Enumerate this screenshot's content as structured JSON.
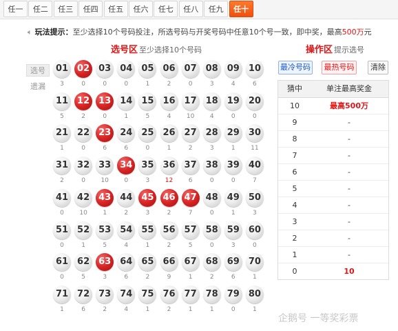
{
  "tabs": [
    "任一",
    "任二",
    "任三",
    "任四",
    "任五",
    "任六",
    "任七",
    "任八",
    "任九",
    "任十"
  ],
  "active_tab_index": 9,
  "tip": {
    "label": "玩法提示：",
    "text_before": "至少选择10个号码投注，所选号码与开奖号码中任意10个号一致，即中奖，最高",
    "amount": "500万",
    "text_after": "元"
  },
  "pick_area": {
    "title": "选号区",
    "subtitle": "至少选择10个号码"
  },
  "row_labels": {
    "pick": "选号",
    "miss": "遗漏"
  },
  "balls": [
    {
      "n": "01",
      "miss": "3",
      "sel": false
    },
    {
      "n": "02",
      "miss": "0",
      "sel": true
    },
    {
      "n": "03",
      "miss": "0",
      "sel": false
    },
    {
      "n": "04",
      "miss": "0",
      "sel": false
    },
    {
      "n": "05",
      "miss": "1",
      "sel": false
    },
    {
      "n": "06",
      "miss": "2",
      "sel": false
    },
    {
      "n": "07",
      "miss": "0",
      "sel": false
    },
    {
      "n": "08",
      "miss": "3",
      "sel": false
    },
    {
      "n": "09",
      "miss": "4",
      "sel": false
    },
    {
      "n": "10",
      "miss": "6",
      "sel": false
    },
    {
      "n": "11",
      "miss": "5",
      "sel": false
    },
    {
      "n": "12",
      "miss": "2",
      "sel": true
    },
    {
      "n": "13",
      "miss": "0",
      "sel": true
    },
    {
      "n": "14",
      "miss": "1",
      "sel": false
    },
    {
      "n": "15",
      "miss": "5",
      "sel": false
    },
    {
      "n": "16",
      "miss": "4",
      "sel": false
    },
    {
      "n": "17",
      "miss": "10",
      "sel": false
    },
    {
      "n": "18",
      "miss": "4",
      "sel": false
    },
    {
      "n": "19",
      "miss": "0",
      "sel": false
    },
    {
      "n": "20",
      "miss": "0",
      "sel": false
    },
    {
      "n": "21",
      "miss": "1",
      "sel": false
    },
    {
      "n": "22",
      "miss": "0",
      "sel": false
    },
    {
      "n": "23",
      "miss": "6",
      "sel": true
    },
    {
      "n": "24",
      "miss": "6",
      "sel": false
    },
    {
      "n": "25",
      "miss": "0",
      "sel": false
    },
    {
      "n": "26",
      "miss": "1",
      "sel": false
    },
    {
      "n": "27",
      "miss": "2",
      "sel": false
    },
    {
      "n": "28",
      "miss": "3",
      "sel": false
    },
    {
      "n": "29",
      "miss": "1",
      "sel": false
    },
    {
      "n": "30",
      "miss": "11",
      "sel": false
    },
    {
      "n": "31",
      "miss": "2",
      "sel": false
    },
    {
      "n": "32",
      "miss": "0",
      "sel": false
    },
    {
      "n": "33",
      "miss": "10",
      "sel": false
    },
    {
      "n": "34",
      "miss": "0",
      "sel": true
    },
    {
      "n": "35",
      "miss": "3",
      "sel": false
    },
    {
      "n": "36",
      "miss": "12",
      "sel": false,
      "red": true
    },
    {
      "n": "37",
      "miss": "6",
      "sel": false
    },
    {
      "n": "38",
      "miss": "0",
      "sel": false
    },
    {
      "n": "39",
      "miss": "0",
      "sel": false
    },
    {
      "n": "40",
      "miss": "7",
      "sel": false
    },
    {
      "n": "41",
      "miss": "0",
      "sel": false
    },
    {
      "n": "42",
      "miss": "10",
      "sel": false
    },
    {
      "n": "43",
      "miss": "1",
      "sel": true
    },
    {
      "n": "44",
      "miss": "2",
      "sel": false
    },
    {
      "n": "45",
      "miss": "3",
      "sel": true
    },
    {
      "n": "46",
      "miss": "2",
      "sel": true
    },
    {
      "n": "47",
      "miss": "7",
      "sel": true
    },
    {
      "n": "48",
      "miss": "0",
      "sel": false
    },
    {
      "n": "49",
      "miss": "1",
      "sel": false
    },
    {
      "n": "50",
      "miss": "3",
      "sel": false
    },
    {
      "n": "51",
      "miss": "0",
      "sel": false
    },
    {
      "n": "52",
      "miss": "1",
      "sel": false
    },
    {
      "n": "53",
      "miss": "5",
      "sel": false
    },
    {
      "n": "54",
      "miss": "4",
      "sel": false
    },
    {
      "n": "55",
      "miss": "1",
      "sel": false
    },
    {
      "n": "56",
      "miss": "2",
      "sel": false
    },
    {
      "n": "57",
      "miss": "5",
      "sel": false
    },
    {
      "n": "58",
      "miss": "0",
      "sel": false
    },
    {
      "n": "59",
      "miss": "3",
      "sel": false
    },
    {
      "n": "60",
      "miss": "0",
      "sel": false
    },
    {
      "n": "61",
      "miss": "0",
      "sel": false
    },
    {
      "n": "62",
      "miss": "5",
      "sel": false
    },
    {
      "n": "63",
      "miss": "3",
      "sel": true
    },
    {
      "n": "64",
      "miss": "6",
      "sel": false
    },
    {
      "n": "65",
      "miss": "2",
      "sel": false
    },
    {
      "n": "66",
      "miss": "9",
      "sel": false
    },
    {
      "n": "67",
      "miss": "1",
      "sel": false
    },
    {
      "n": "68",
      "miss": "2",
      "sel": false
    },
    {
      "n": "69",
      "miss": "6",
      "sel": false
    },
    {
      "n": "70",
      "miss": "1",
      "sel": false
    },
    {
      "n": "71",
      "miss": "1",
      "sel": false
    },
    {
      "n": "72",
      "miss": "6",
      "sel": false
    },
    {
      "n": "73",
      "miss": "2",
      "sel": false
    },
    {
      "n": "74",
      "miss": "4",
      "sel": false
    },
    {
      "n": "75",
      "miss": "1",
      "sel": false
    },
    {
      "n": "76",
      "miss": "2",
      "sel": false
    },
    {
      "n": "77",
      "miss": "1",
      "sel": false
    },
    {
      "n": "78",
      "miss": "1",
      "sel": false
    },
    {
      "n": "79",
      "miss": "0",
      "sel": false
    },
    {
      "n": "80",
      "miss": "1",
      "sel": false
    }
  ],
  "op_area": {
    "title": "操作区",
    "subtitle": "提示选号",
    "buttons": {
      "cold": "最冷号码",
      "hot": "最热号码",
      "clear": "清除"
    }
  },
  "prize_table": {
    "headers": [
      "猜中",
      "单注最高奖金"
    ],
    "rows": [
      {
        "hit": "10",
        "prize": "最高500万",
        "red": true
      },
      {
        "hit": "9",
        "prize": "-"
      },
      {
        "hit": "8",
        "prize": "-"
      },
      {
        "hit": "7",
        "prize": "-"
      },
      {
        "hit": "6",
        "prize": "-"
      },
      {
        "hit": "5",
        "prize": "-"
      },
      {
        "hit": "4",
        "prize": "-"
      },
      {
        "hit": "3",
        "prize": "-"
      },
      {
        "hit": "2",
        "prize": "-"
      },
      {
        "hit": "1",
        "prize": "-"
      },
      {
        "hit": "0",
        "prize": "10",
        "red": true
      }
    ]
  },
  "watermark": "企鹅号 一等奖彩票",
  "colors": {
    "accent": "#e01414",
    "tab_active": "#ee4f10",
    "cold": "#1a58c9"
  }
}
